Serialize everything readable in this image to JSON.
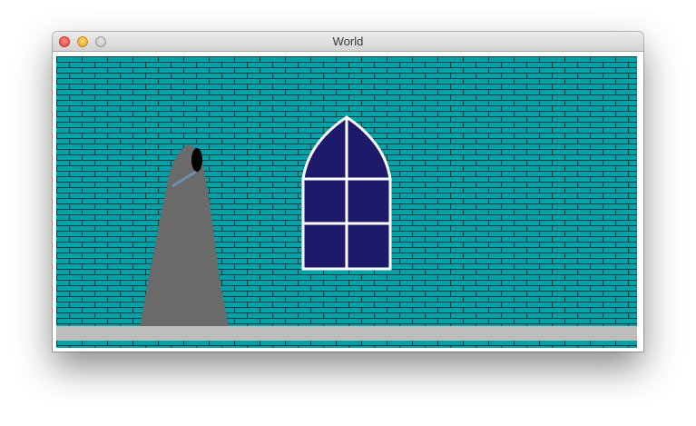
{
  "window": {
    "title": "World",
    "controls": [
      "close-button",
      "minimize-button",
      "zoom-button"
    ]
  },
  "scene": {
    "wall_color": "#00a2a8",
    "mortar_color": "#003f45",
    "ledge_color": "#bdbdbd",
    "window_glass_color": "#1e1a6b",
    "window_frame_color": "#ffffff",
    "figure_color": "#6a6a6a",
    "hood_opening_color": "#000000",
    "sash_color": "#6f8fb0",
    "elements": [
      "brick-wall",
      "arched-window",
      "hooded-figure",
      "stone-ledge"
    ]
  }
}
